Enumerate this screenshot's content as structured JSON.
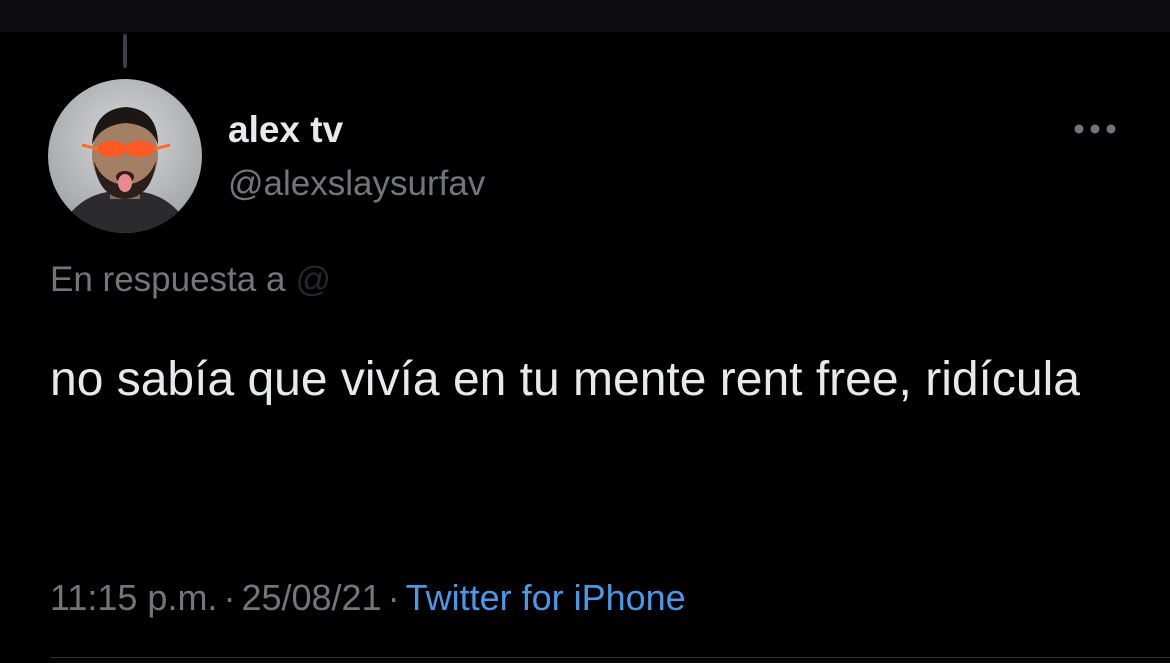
{
  "tweet": {
    "author": {
      "display_name": "alex tv",
      "handle": "@alexslaysurfav",
      "avatar_icon": "user-avatar-photo"
    },
    "more_icon": "more-horizontal-icon",
    "reply_context": {
      "label": "En respuesta a",
      "mention": "@"
    },
    "text": "no sabía que vivía en tu mente rent free, ridícula",
    "meta": {
      "time": "11:15 p.m.",
      "separator": "·",
      "date": "25/08/21",
      "source": "Twitter for iPhone"
    }
  },
  "colors": {
    "background": "#000000",
    "primary_text": "#e7e9ea",
    "secondary_text": "#71767b",
    "link": "#4a99e9"
  }
}
